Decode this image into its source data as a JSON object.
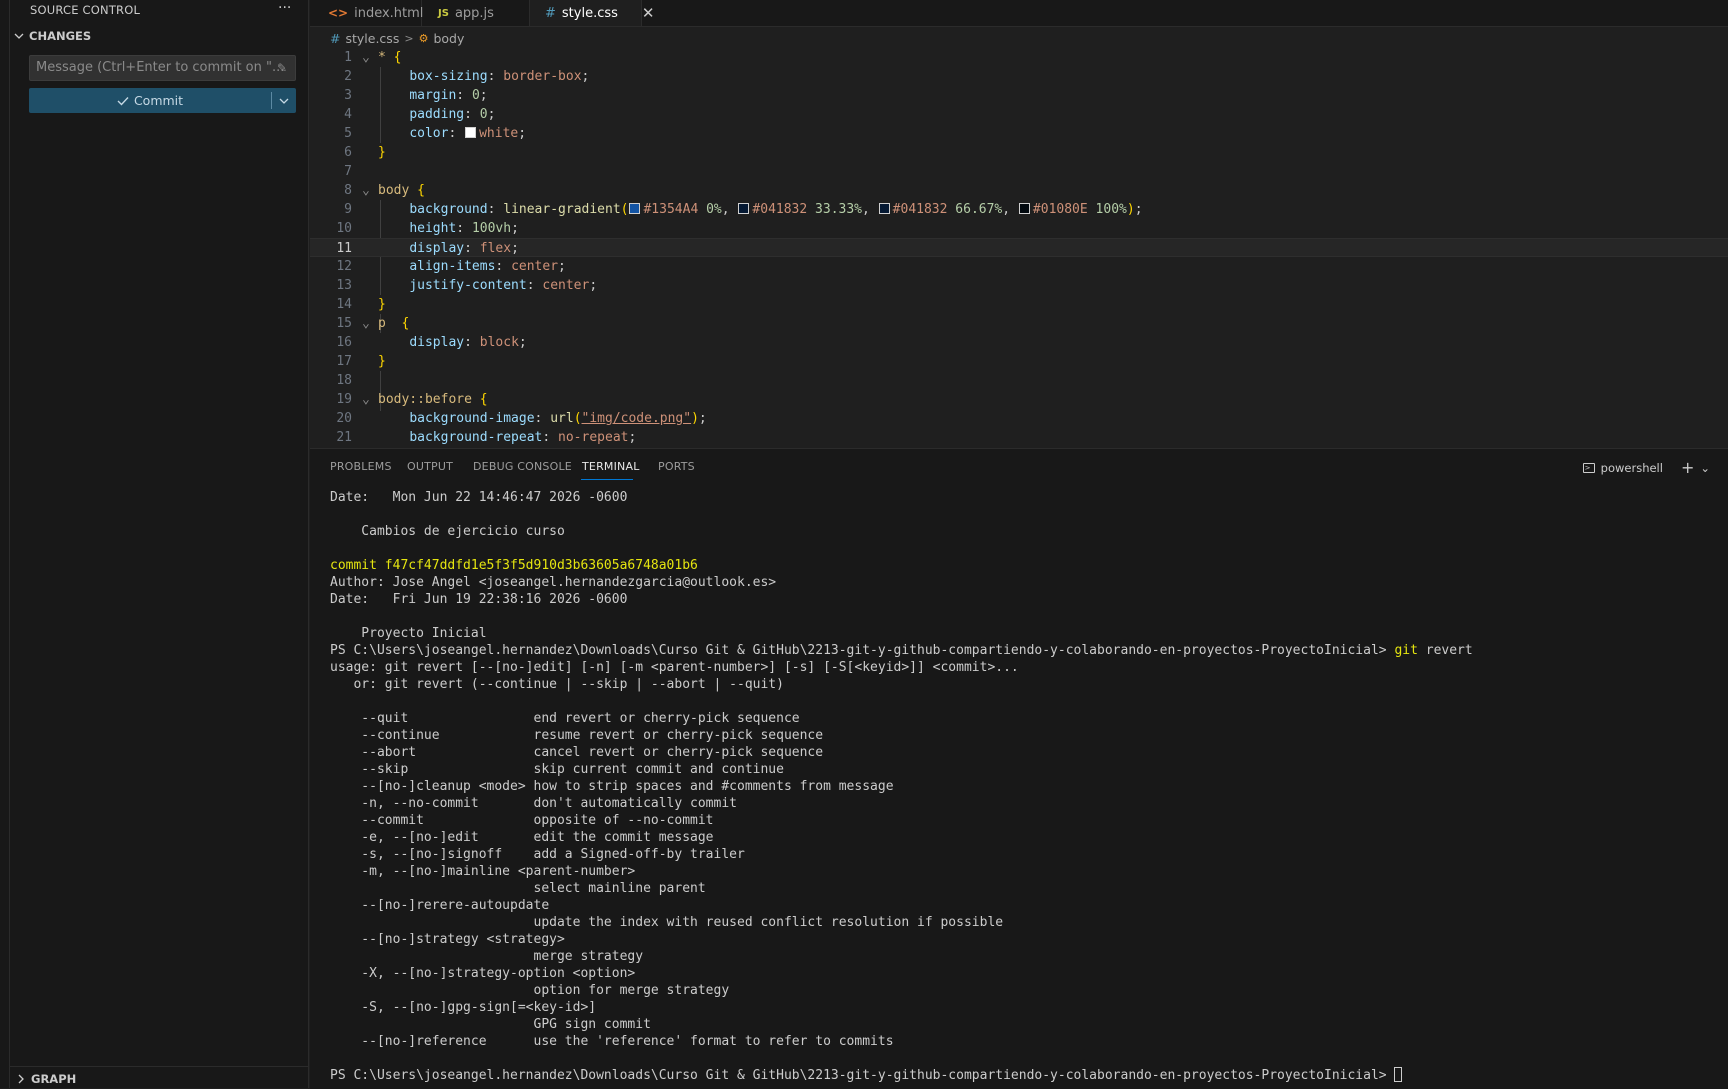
{
  "sidebar": {
    "title": "SOURCE CONTROL",
    "more": "···",
    "changes_label": "CHANGES",
    "message_placeholder": "Message (Ctrl+Enter to commit on \"...",
    "commit_label": "Commit",
    "graph_label": "GRAPH"
  },
  "tabs": [
    {
      "icon": "<>",
      "label": "index.html"
    },
    {
      "icon": "JS",
      "label": "app.js"
    },
    {
      "icon": "#",
      "label": "style.css",
      "active": true,
      "close": "✕"
    }
  ],
  "breadcrumb": {
    "file_icon": "#",
    "file": "style.css",
    "symbol_icon": "⚙",
    "symbol": "body"
  },
  "editor": {
    "current_line": 11,
    "line_numbers": [
      "1",
      "2",
      "3",
      "4",
      "5",
      "6",
      "7",
      "8",
      "9",
      "10",
      "11",
      "12",
      "13",
      "14",
      "15",
      "16",
      "17",
      "18",
      "19",
      "20",
      "21"
    ],
    "colors": {
      "swatch_1": "#1354A4",
      "swatch_2": "#041832",
      "swatch_3": "#041832",
      "swatch_4": "#01080E",
      "swatch_white": "#ffffff"
    },
    "code": {
      "l1_sel": "*",
      "l1_br": "{",
      "l2_prop": "box-sizing",
      "l2_val": "border-box",
      "l3_prop": "margin",
      "l3_val": "0",
      "l4_prop": "padding",
      "l4_val": "0",
      "l5_prop": "color",
      "l5_val": "white",
      "l6_br": "}",
      "l8_sel": "body",
      "l8_br": "{",
      "l9_prop": "background",
      "l9_fn": "linear-gradient",
      "l9_c1": "#1354A4",
      "l9_p1": "0%",
      "l9_c2": "#041832",
      "l9_p2": "33.33%",
      "l9_c3": "#041832",
      "l9_p3": "66.67%",
      "l9_c4": "#01080E",
      "l9_p4": "100%",
      "l10_prop": "height",
      "l10_val": "100vh",
      "l11_prop": "display",
      "l11_val": "flex",
      "l12_prop": "align-items",
      "l12_val": "center",
      "l13_prop": "justify-content",
      "l13_val": "center",
      "l14_br": "}",
      "l15_sel": "p",
      "l15_br": "{",
      "l16_prop": "display",
      "l16_val": "block",
      "l17_br": "}",
      "l19_sel": "body::before",
      "l19_br": "{",
      "l20_prop": "background-image",
      "l20_fn": "url",
      "l20_str": "\"img/code.png\"",
      "l21_prop": "background-repeat",
      "l21_val": "no-repeat"
    }
  },
  "panel": {
    "tabs": [
      "PROBLEMS",
      "OUTPUT",
      "DEBUG CONSOLE",
      "TERMINAL",
      "PORTS"
    ],
    "active_tab": "TERMINAL",
    "shell": "powershell",
    "add": "+",
    "add_menu": "⌄"
  },
  "terminal": {
    "lines": [
      "Date:   Mon Jun 22 14:46:47 2026 -0600",
      "",
      "    Cambios de ejercicio curso",
      "",
      "commit f47cf47ddfd1e5f3f5d910d3b63605a6748a01b6",
      "Author: Jose Angel <joseangel.hernandezgarcia@outlook.es>",
      "Date:   Fri Jun 19 22:38:16 2026 -0600",
      "",
      "    Proyecto Inicial",
      "PS C:\\Users\\joseangel.hernandez\\Downloads\\Curso Git & GitHub\\2213-git-y-github-compartiendo-y-colaborando-en-proyectos-ProyectoInicial> git revert",
      "usage: git revert [--[no-]edit] [-n] [-m <parent-number>] [-s] [-S[<keyid>]] <commit>...",
      "   or: git revert (--continue | --skip | --abort | --quit)",
      "",
      "    --quit                end revert or cherry-pick sequence",
      "    --continue            resume revert or cherry-pick sequence",
      "    --abort               cancel revert or cherry-pick sequence",
      "    --skip                skip current commit and continue",
      "    --[no-]cleanup <mode> how to strip spaces and #comments from message",
      "    -n, --no-commit       don't automatically commit",
      "    --commit              opposite of --no-commit",
      "    -e, --[no-]edit       edit the commit message",
      "    -s, --[no-]signoff    add a Signed-off-by trailer",
      "    -m, --[no-]mainline <parent-number>",
      "                          select mainline parent",
      "    --[no-]rerere-autoupdate",
      "                          update the index with reused conflict resolution if possible",
      "    --[no-]strategy <strategy>",
      "                          merge strategy",
      "    -X, --[no-]strategy-option <option>",
      "                          option for merge strategy",
      "    -S, --[no-]gpg-sign[=<key-id>]",
      "                          GPG sign commit",
      "    --[no-]reference      use the 'reference' format to refer to commits",
      "",
      "PS C:\\Users\\joseangel.hernandez\\Downloads\\Curso Git & GitHub\\2213-git-y-github-compartiendo-y-colaborando-en-proyectos-ProyectoInicial> "
    ]
  }
}
